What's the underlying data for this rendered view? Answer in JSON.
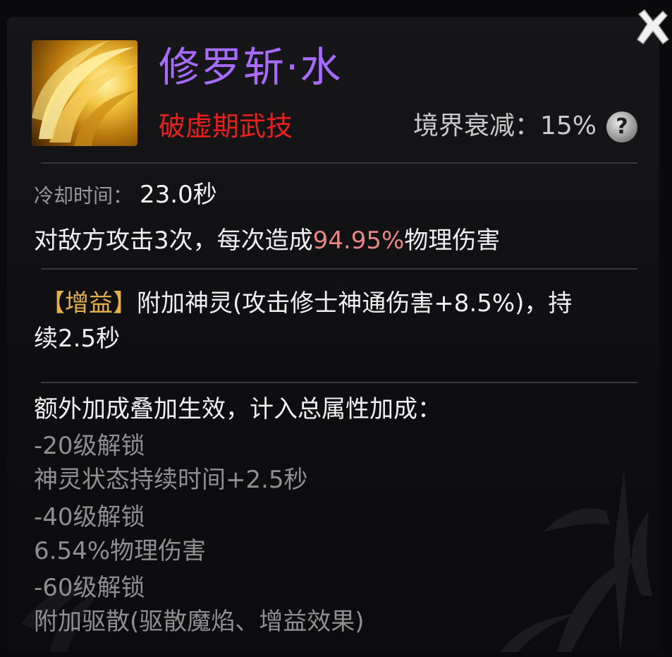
{
  "skill": {
    "name": "修罗斩·水",
    "type": "破虚期武技",
    "realm_label": "境界衰减：",
    "realm_value": "15%",
    "help_glyph": "?",
    "icon_name": "golden-slash-skill-icon"
  },
  "cooldown": {
    "label": "冷却时间：",
    "value": "23.0秒"
  },
  "effect": {
    "prefix": "对敌方攻击3次，每次造成",
    "percent": "94.95%",
    "suffix": "物理伤害"
  },
  "buff": {
    "bracket_open": "【",
    "tag": "增益",
    "bracket_close": "】",
    "line1": "附加神灵(攻击修士神通伤害+8.5%)，持",
    "line2": "续2.5秒"
  },
  "extra": {
    "header": "额外加成叠加生效，计入总属性加成：",
    "items": [
      {
        "unlock": "-20级解锁",
        "bonus": "神灵状态持续时间+2.5秒"
      },
      {
        "unlock": "-40级解锁",
        "bonus": "6.54%物理伤害"
      },
      {
        "unlock": "-60级解锁",
        "bonus": "附加驱散(驱散魔焰、增益效果)"
      }
    ]
  },
  "colors": {
    "name": "#a86bff",
    "type": "#e8201c",
    "percent_highlight": "#e88585",
    "buff_tag": "#e3b04a",
    "locked_text": "#8f8f8f"
  }
}
